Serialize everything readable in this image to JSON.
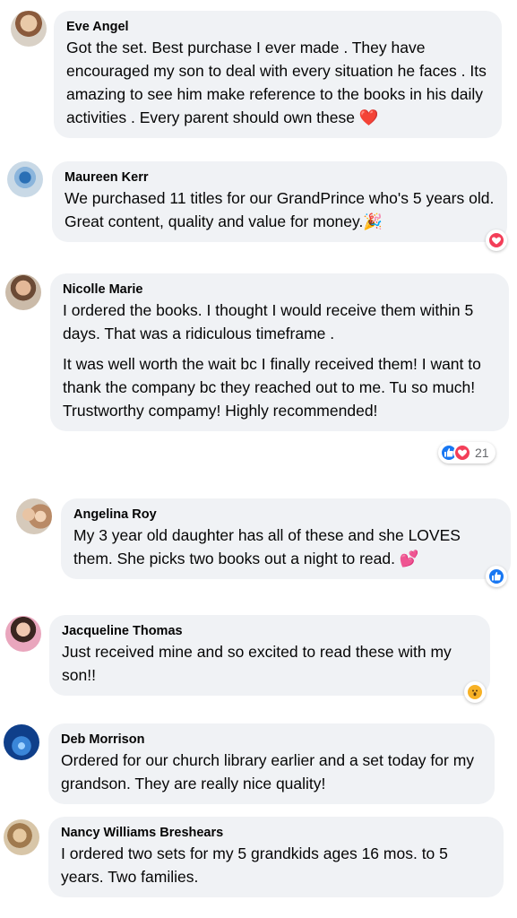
{
  "colors": {
    "bubble_bg": "#f0f2f5",
    "like_blue": "#1877f2",
    "love_red": "#f33e58",
    "wow_yellow": "#f7b125",
    "count_gray": "#65676b"
  },
  "comments": [
    {
      "name": "Eve Angel",
      "paragraphs": [
        "Got the set. Best purchase I ever made . They have encouraged my son to deal with every situation he faces . Its amazing to see him make reference to the books in his daily activities . Every parent should own these ❤️"
      ],
      "reactions": [],
      "reaction_count": ""
    },
    {
      "name": "Maureen Kerr",
      "paragraphs": [
        "We purchased 11 titles for our GrandPrince who's 5 years old. Great content, quality and value for money.🎉"
      ],
      "reactions": [
        "love"
      ],
      "reaction_count": ""
    },
    {
      "name": "Nicolle Marie",
      "paragraphs": [
        "I ordered the books. I thought I would receive them within 5 days. That was a ridiculous timeframe .",
        "It was well worth the wait bc I finally received them! I want to thank the company bc they reached out to me. Tu so much! Trustworthy compamy! Highly recommended!"
      ],
      "reactions": [
        "like",
        "love"
      ],
      "reaction_count": "21"
    },
    {
      "name": "Angelina Roy",
      "paragraphs": [
        "My 3 year old daughter has all of these and she LOVES them. She picks two books out a night to read. 💕"
      ],
      "reactions": [
        "like"
      ],
      "reaction_count": ""
    },
    {
      "name": "Jacqueline Thomas",
      "paragraphs": [
        "Just received mine and so excited to read these with my son!!"
      ],
      "reactions": [
        "wow"
      ],
      "reaction_count": ""
    },
    {
      "name": "Deb Morrison",
      "paragraphs": [
        "Ordered for our church library earlier and a set today for my grandson. They are really nice quality!"
      ],
      "reactions": [],
      "reaction_count": ""
    },
    {
      "name": "Nancy Williams Breshears",
      "paragraphs": [
        "I ordered two sets for my 5 grandkids ages 16 mos. to 5 years. Two families."
      ],
      "reactions": [],
      "reaction_count": ""
    }
  ]
}
